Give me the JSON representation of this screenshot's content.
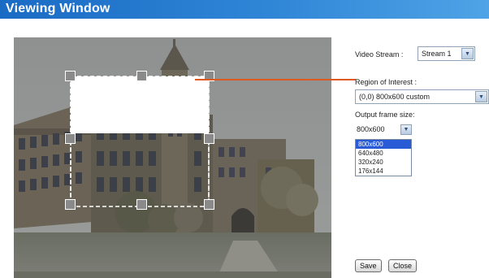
{
  "window": {
    "title": "Viewing Window"
  },
  "video_stream": {
    "label": "Video Stream :",
    "value": "Stream 1"
  },
  "region_of_interest": {
    "label": "Region of Interest :",
    "value": "(0,0) 800x600 custom"
  },
  "output_frame_size": {
    "label": "Output frame size:",
    "value": "800x600",
    "options": [
      {
        "label": "800x600",
        "selected": true
      },
      {
        "label": "640x480",
        "selected": false
      },
      {
        "label": "320x240",
        "selected": false
      },
      {
        "label": "176x144",
        "selected": false
      }
    ]
  },
  "buttons": {
    "save": "Save",
    "close": "Close"
  },
  "colors": {
    "title_bar": "#2f86d6",
    "connector_line": "#e05a1f",
    "dropdown_selected": "#2a5bd7"
  },
  "icons": [
    "chevron-down-icon",
    "roi-resize-handle-icon"
  ]
}
